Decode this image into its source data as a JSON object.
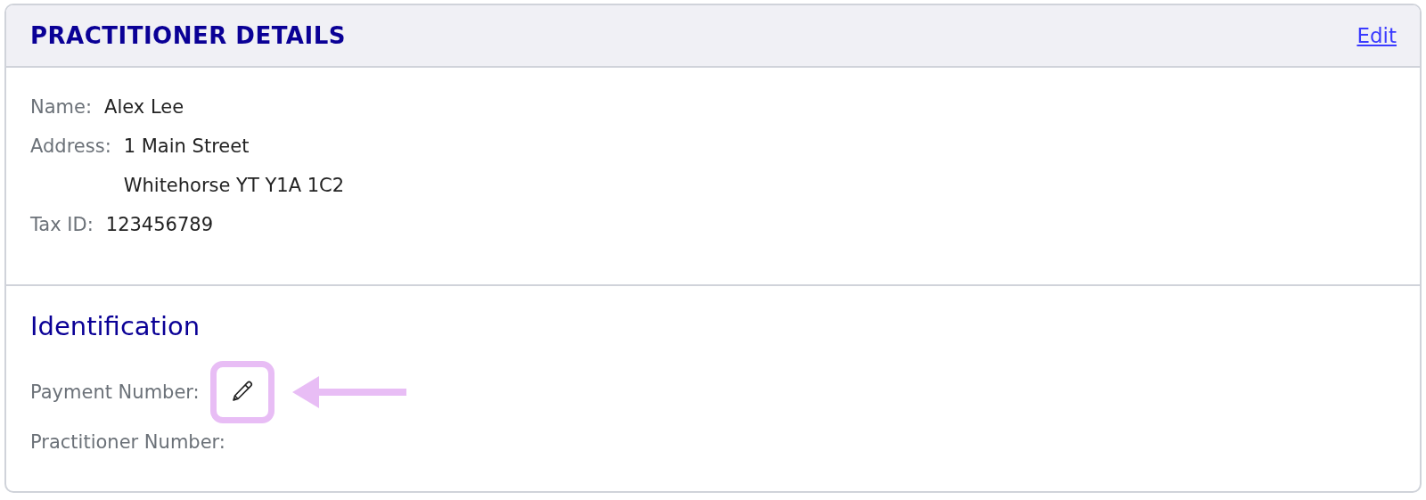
{
  "card": {
    "title": "PRACTITIONER DETAILS",
    "edit_link": "Edit"
  },
  "details": [
    {
      "label": "Name:",
      "lines": [
        "Alex Lee"
      ]
    },
    {
      "label": "Address:",
      "lines": [
        "1 Main Street",
        "Whitehorse YT Y1A 1C2"
      ]
    },
    {
      "label": "Tax ID:",
      "lines": [
        "123456789"
      ]
    }
  ],
  "identification": {
    "heading": "Identification",
    "fields": [
      {
        "label": "Payment Number:",
        "kind": "editable"
      },
      {
        "label": "Practitioner Number:",
        "kind": "plain"
      }
    ]
  }
}
